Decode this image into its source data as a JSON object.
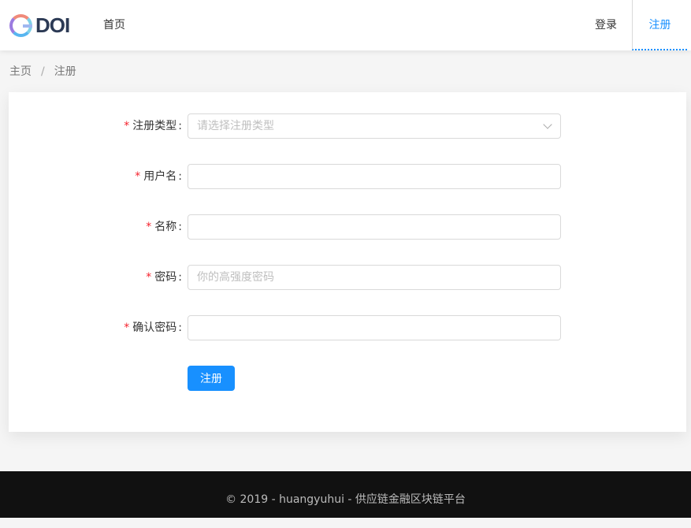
{
  "header": {
    "logo_text": "DOI",
    "nav": {
      "home": "首页",
      "login": "登录",
      "register": "注册"
    }
  },
  "breadcrumb": {
    "items": [
      "主页",
      "注册"
    ],
    "separator": "/"
  },
  "form": {
    "required_mark": "*",
    "colon": ":",
    "register_type": {
      "label": "注册类型",
      "placeholder": "请选择注册类型"
    },
    "username": {
      "label": "用户名",
      "value": ""
    },
    "name": {
      "label": "名称",
      "value": ""
    },
    "password": {
      "label": "密码",
      "placeholder": "你的高强度密码"
    },
    "confirm_password": {
      "label": "确认密码",
      "value": ""
    },
    "submit_label": "注册"
  },
  "footer": {
    "text": "© 2019 - huangyuhui - 供应链金融区块链平台"
  },
  "colors": {
    "primary": "#1890ff",
    "required": "#f5222d",
    "footer_bg": "#111111"
  }
}
